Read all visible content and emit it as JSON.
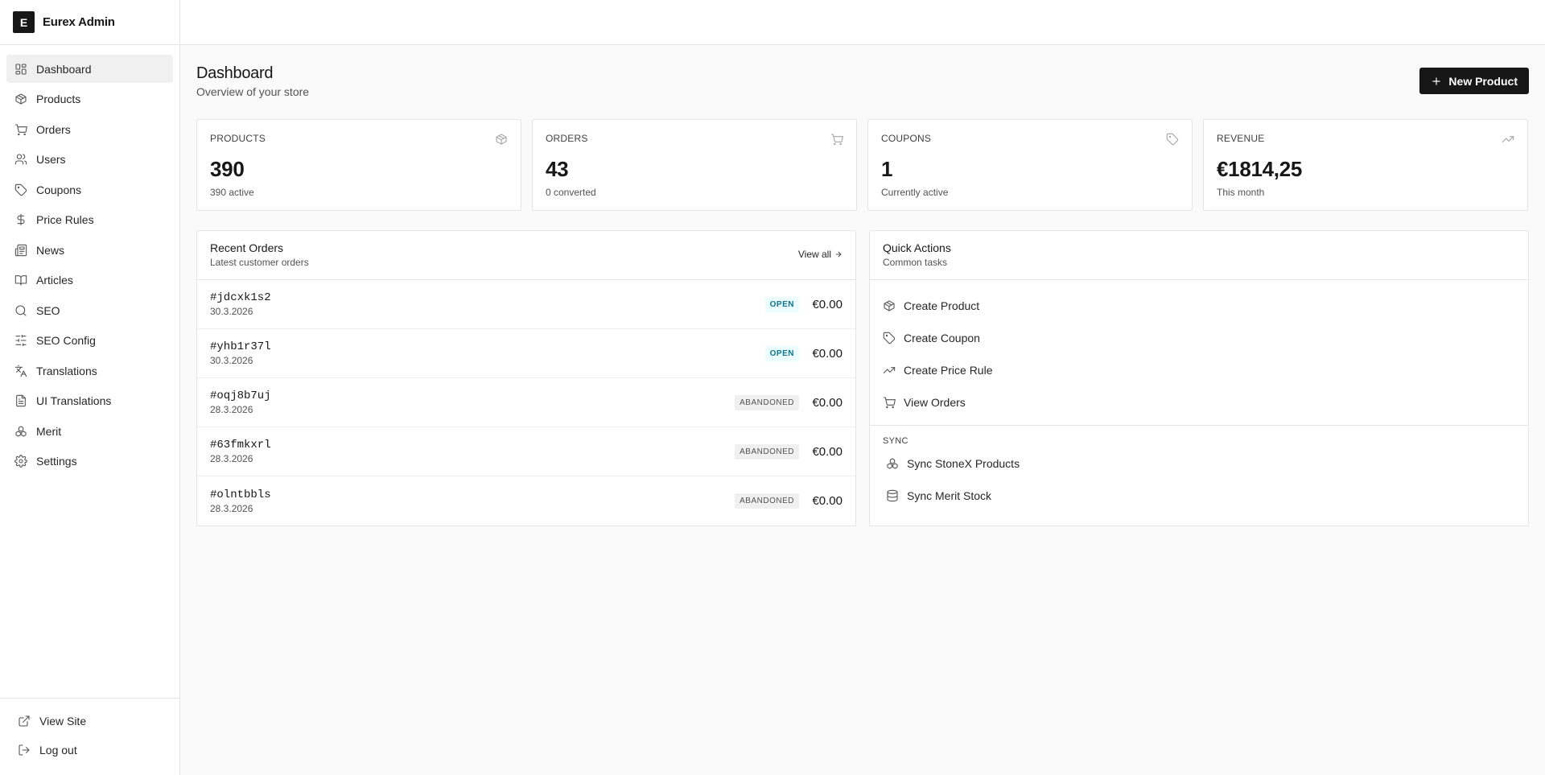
{
  "brand": {
    "logo_letter": "E",
    "name": "Eurex Admin"
  },
  "sidebar": {
    "items": [
      {
        "label": "Dashboard",
        "icon": "layout-grid-icon",
        "active": true
      },
      {
        "label": "Products",
        "icon": "package-icon"
      },
      {
        "label": "Orders",
        "icon": "cart-icon"
      },
      {
        "label": "Users",
        "icon": "users-icon"
      },
      {
        "label": "Coupons",
        "icon": "tag-icon"
      },
      {
        "label": "Price Rules",
        "icon": "dollar-icon"
      },
      {
        "label": "News",
        "icon": "newspaper-icon"
      },
      {
        "label": "Articles",
        "icon": "book-icon"
      },
      {
        "label": "SEO",
        "icon": "search-icon"
      },
      {
        "label": "SEO Config",
        "icon": "sliders-icon"
      },
      {
        "label": "Translations",
        "icon": "languages-icon"
      },
      {
        "label": "UI Translations",
        "icon": "file-text-icon"
      },
      {
        "label": "Merit",
        "icon": "boxes-icon"
      },
      {
        "label": "Settings",
        "icon": "gear-icon"
      }
    ],
    "footer": [
      {
        "label": "View Site",
        "icon": "external-link-icon"
      },
      {
        "label": "Log out",
        "icon": "log-out-icon"
      }
    ]
  },
  "header": {
    "title": "Dashboard",
    "subtitle": "Overview of your store",
    "new_product_label": "New Product"
  },
  "stats": [
    {
      "label": "Products",
      "value": "390",
      "sub": "390 active",
      "icon": "package-icon"
    },
    {
      "label": "Orders",
      "value": "43",
      "sub": "0 converted",
      "icon": "cart-icon"
    },
    {
      "label": "Coupons",
      "value": "1",
      "sub": "Currently active",
      "icon": "tag-icon"
    },
    {
      "label": "Revenue",
      "value": "€1814,25",
      "sub": "This month",
      "icon": "trending-up-icon"
    }
  ],
  "recent_orders": {
    "title": "Recent Orders",
    "subtitle": "Latest customer orders",
    "view_all_label": "View all",
    "orders": [
      {
        "id": "#jdcxk1s2",
        "date": "30.3.2026",
        "status": "OPEN",
        "total": "€0.00"
      },
      {
        "id": "#yhb1r37l",
        "date": "30.3.2026",
        "status": "OPEN",
        "total": "€0.00"
      },
      {
        "id": "#oqj8b7uj",
        "date": "28.3.2026",
        "status": "ABANDONED",
        "total": "€0.00"
      },
      {
        "id": "#63fmkxrl",
        "date": "28.3.2026",
        "status": "ABANDONED",
        "total": "€0.00"
      },
      {
        "id": "#olntbbls",
        "date": "28.3.2026",
        "status": "ABANDONED",
        "total": "€0.00"
      }
    ]
  },
  "quick_actions": {
    "title": "Quick Actions",
    "subtitle": "Common tasks",
    "items": [
      {
        "label": "Create Product",
        "icon": "package-icon"
      },
      {
        "label": "Create Coupon",
        "icon": "tag-icon"
      },
      {
        "label": "Create Price Rule",
        "icon": "trending-up-icon"
      },
      {
        "label": "View Orders",
        "icon": "cart-icon"
      }
    ],
    "sync_label": "Sync",
    "sync_items": [
      {
        "label": "Sync StoneX Products",
        "icon": "boxes-icon"
      },
      {
        "label": "Sync Merit Stock",
        "icon": "database-icon"
      }
    ]
  },
  "colors": {
    "primary": "#171717",
    "badge_open_bg": "#ecfeff",
    "badge_open_text": "#0e7490",
    "badge_abandoned_bg": "#f0f0f0"
  }
}
